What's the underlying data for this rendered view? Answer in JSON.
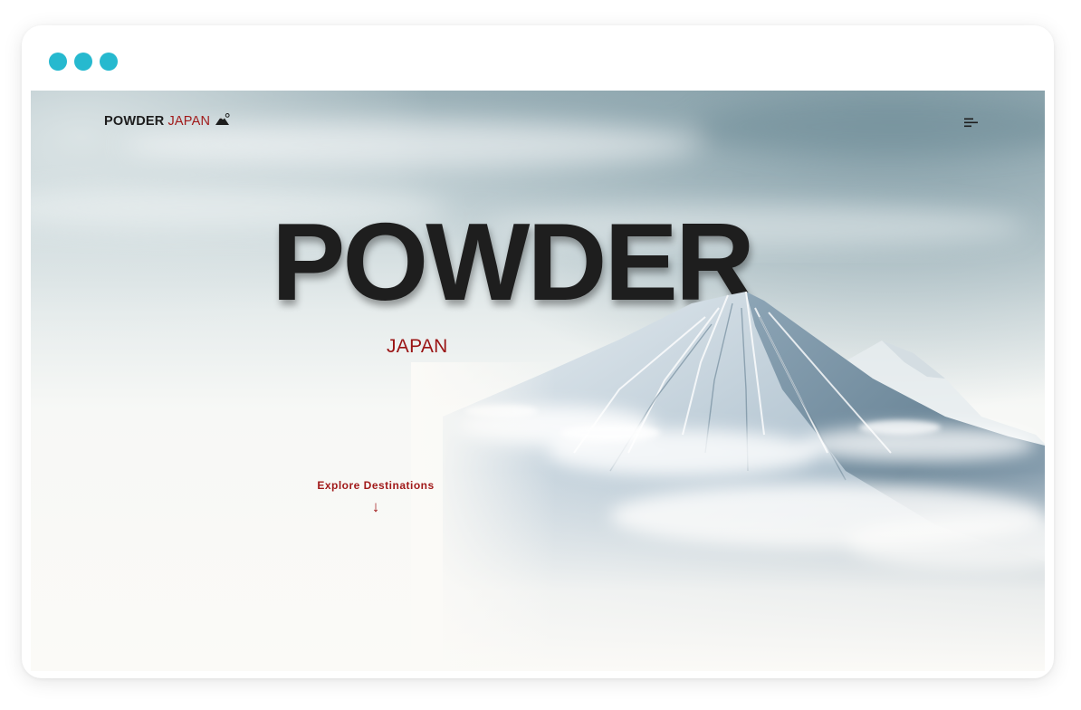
{
  "window": {
    "control_dots": [
      "dot-1",
      "dot-2",
      "dot-3"
    ],
    "dot_color": "#26b9cf"
  },
  "nav": {
    "logo_primary": "POWDER",
    "logo_accent": "JAPAN",
    "logo_icon": "mountain-sun-icon",
    "menu_icon": "menu-lines-icon"
  },
  "hero": {
    "title": "POWDER",
    "subtitle": "JAPAN",
    "cta_label": "Explore Destinations",
    "cta_icon": "↓"
  },
  "colors": {
    "accent": "#a11a1a",
    "title": "#1e1e1e",
    "background": "#fbfaf7"
  }
}
